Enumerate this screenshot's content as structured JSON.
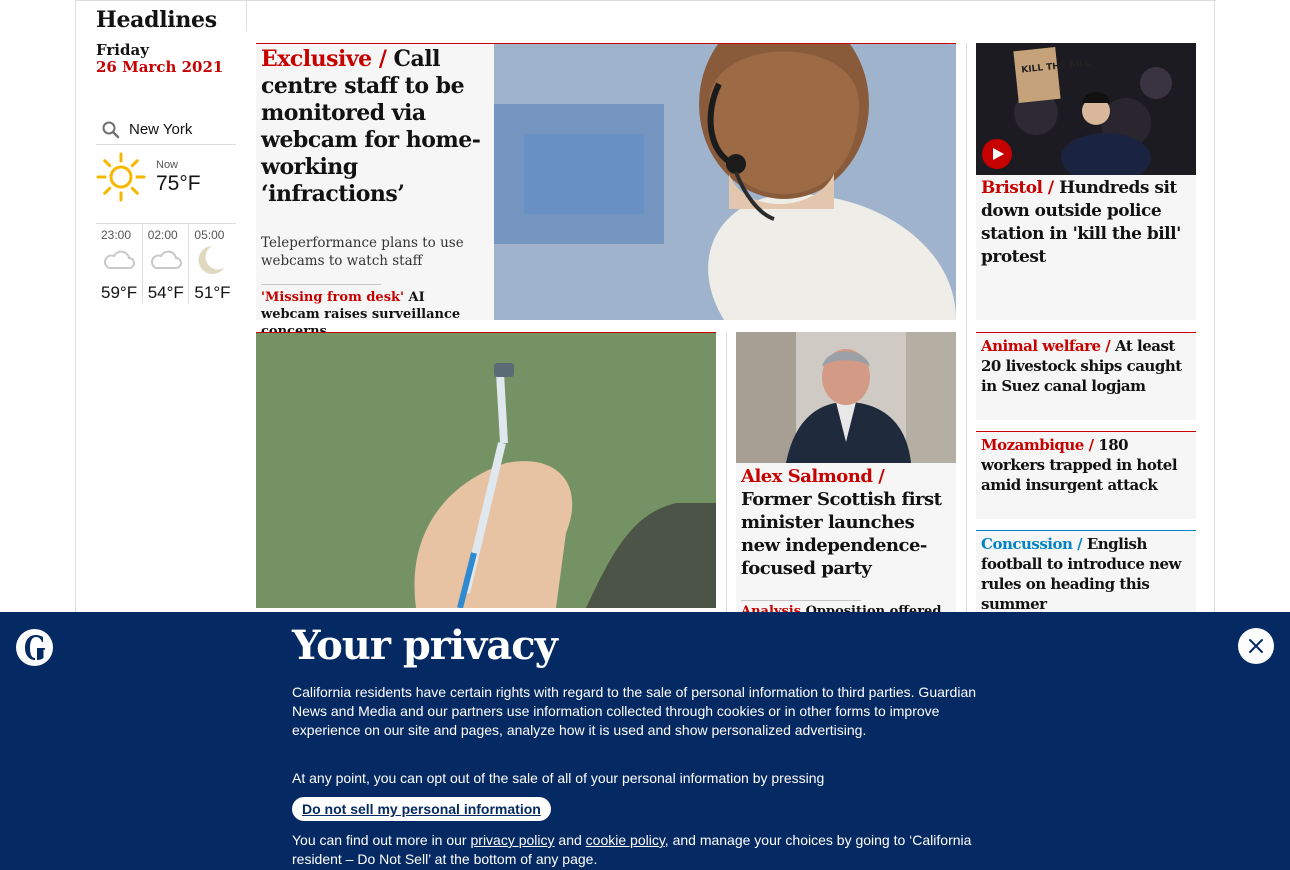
{
  "section": {
    "title": "Headlines",
    "day": "Friday",
    "date": "26 March 2021"
  },
  "weather": {
    "location": "New York",
    "now_label": "Now",
    "now_temp": "75°F",
    "now_icon": "sun-icon",
    "forecast": [
      {
        "time": "23:00",
        "temp": "59°F",
        "icon": "cloud-night-icon"
      },
      {
        "time": "02:00",
        "temp": "54°F",
        "icon": "cloud-night-icon"
      },
      {
        "time": "05:00",
        "temp": "51°F",
        "icon": "moon-icon"
      }
    ]
  },
  "top_story": {
    "kicker": "Exclusive /",
    "headline": "Call centre staff to be monitored via webcam for home-working ‘infractions’",
    "standfirst": "Teleperformance plans to use webcams to watch staff",
    "sub_kicker": "'Missing from desk'",
    "sub_text": "AI webcam raises surveillance concerns"
  },
  "bristol": {
    "kicker": "Bristol /",
    "headline": "Hundreds sit down outside police station in 'kill the bill' protest",
    "sign_text": "KILL THE BILL"
  },
  "small_stories": [
    {
      "kicker": "Animal welfare /",
      "headline": "At least 20 livestock ships caught in Suez canal logjam"
    },
    {
      "kicker": "Mozambique /",
      "headline": "180 workers trapped in hotel amid insurgent attack"
    },
    {
      "kicker": "Concussion /",
      "headline": "English football to introduce new rules on heading this summer"
    }
  ],
  "salmond": {
    "kicker": "Alex Salmond /",
    "headline": "Former Scottish first minister launches new independence-focused party",
    "sub_kicker": "Analysis",
    "sub_text": "Opposition offered"
  },
  "privacy": {
    "title": "Your privacy",
    "p1": "California residents have certain rights with regard to the sale of personal information to third parties. Guardian News and Media and our partners use information collected through cookies or in other forms to improve experience on our site and pages, analyze how it is used and show personalized advertising.",
    "p2": "At any point, you can opt out of the sale of all of your personal information by pressing",
    "button": "Do not sell my personal information",
    "p3_a": "You can find out more in our",
    "privacy_link": "privacy policy",
    "p3_and": "and",
    "cookie_link": "cookie policy",
    "p3_b": ", and manage your choices by going to ‘California resident – Do Not Sell’ at the bottom of any page."
  },
  "colors": {
    "news_red": "#c70000",
    "sport_blue": "#0084c6",
    "brand_navy": "#052962"
  }
}
